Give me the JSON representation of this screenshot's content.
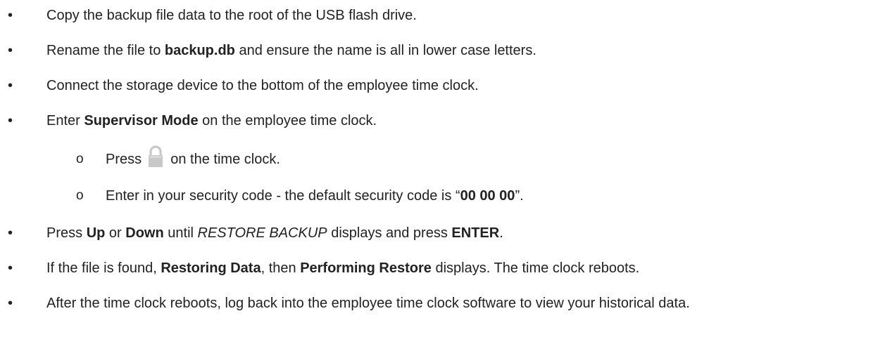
{
  "bullet_glyph": "•",
  "sub_bullet_glyph": "o",
  "items": [
    {
      "parts": [
        {
          "t": "Copy the backup file data to the root of the USB flash drive."
        }
      ]
    },
    {
      "parts": [
        {
          "t": "Rename the file to "
        },
        {
          "b": "backup.db"
        },
        {
          "t": " and ensure the name is all in lower case letters."
        }
      ]
    },
    {
      "parts": [
        {
          "t": "Connect the storage device to the bottom of the employee time clock."
        }
      ]
    },
    {
      "parts": [
        {
          "t": "Enter "
        },
        {
          "b": "Supervisor Mode"
        },
        {
          "t": " on the employee time clock."
        }
      ]
    },
    {
      "parts": [
        {
          "t": "Press "
        },
        {
          "icon": "lock-icon"
        },
        {
          "t": " on the time clock."
        }
      ]
    },
    {
      "parts": [
        {
          "t": "Enter in your security code - the default security code is “"
        },
        {
          "b": "00 00 00"
        },
        {
          "t": "”."
        }
      ]
    },
    {
      "parts": [
        {
          "t": "Press "
        },
        {
          "b": "Up"
        },
        {
          "t": " or "
        },
        {
          "b": "Down"
        },
        {
          "t": " until "
        },
        {
          "i": "RESTORE BACKUP"
        },
        {
          "t": " displays and press "
        },
        {
          "b": "ENTER"
        },
        {
          "t": "."
        }
      ]
    },
    {
      "parts": [
        {
          "t": "If the file is found, "
        },
        {
          "b": "Restoring Data"
        },
        {
          "t": ", then "
        },
        {
          "b": "Performing Restore"
        },
        {
          "t": " displays. The time clock reboots."
        }
      ]
    },
    {
      "parts": [
        {
          "t": "After the time clock reboots, log back into the employee time clock software to view your historical data."
        }
      ]
    }
  ],
  "colors": {
    "text": "#222222",
    "lock_icon": "#c8c8c8"
  }
}
